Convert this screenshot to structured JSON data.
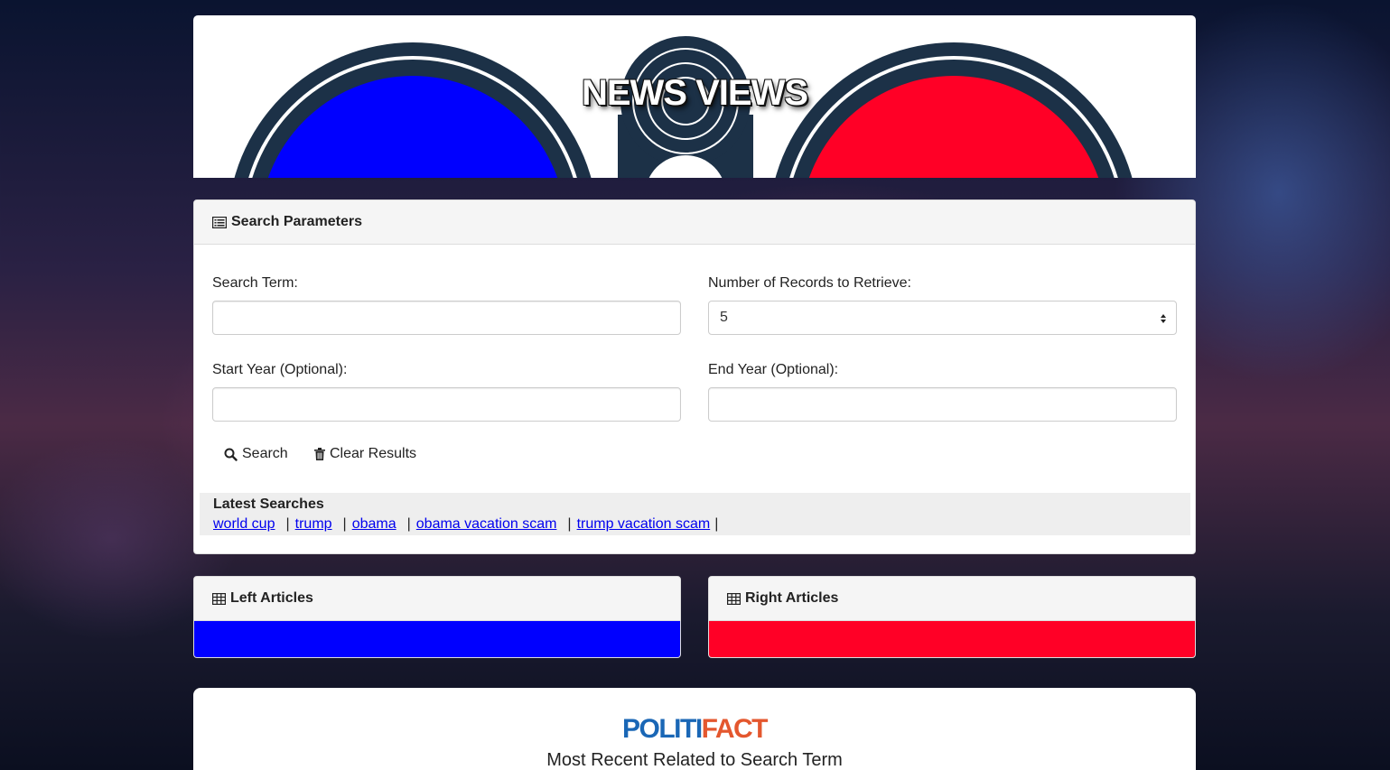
{
  "header": {
    "title": "NEWS VIEWS",
    "left_color": "#0000ff",
    "right_color": "#ff0026",
    "ring_color": "#1c3147"
  },
  "search_panel": {
    "heading": "Search Parameters",
    "heading_icon": "list-alt-icon",
    "search_term_label": "Search Term:",
    "search_term_value": "",
    "records_label": "Number of Records to Retrieve:",
    "records_value": "5",
    "start_year_label": "Start Year (Optional):",
    "start_year_value": "",
    "end_year_label": "End Year (Optional):",
    "end_year_value": "",
    "search_button": "Search",
    "search_icon": "search-icon",
    "clear_button": "Clear Results",
    "clear_icon": "trash-icon"
  },
  "latest_searches": {
    "title": "Latest Searches",
    "items": [
      "world cup",
      "trump",
      "obama",
      "obama vacation scam",
      "trump vacation scam"
    ],
    "separator": "|"
  },
  "left_articles": {
    "heading": "Left Articles",
    "icon": "table-icon",
    "color": "#0000ff"
  },
  "right_articles": {
    "heading": "Right Articles",
    "icon": "table-icon",
    "color": "#ff0026"
  },
  "politifact": {
    "logo_part1": "POLITI",
    "logo_part2": "FACT",
    "subtitle": "Most Recent Related to Search Term"
  }
}
